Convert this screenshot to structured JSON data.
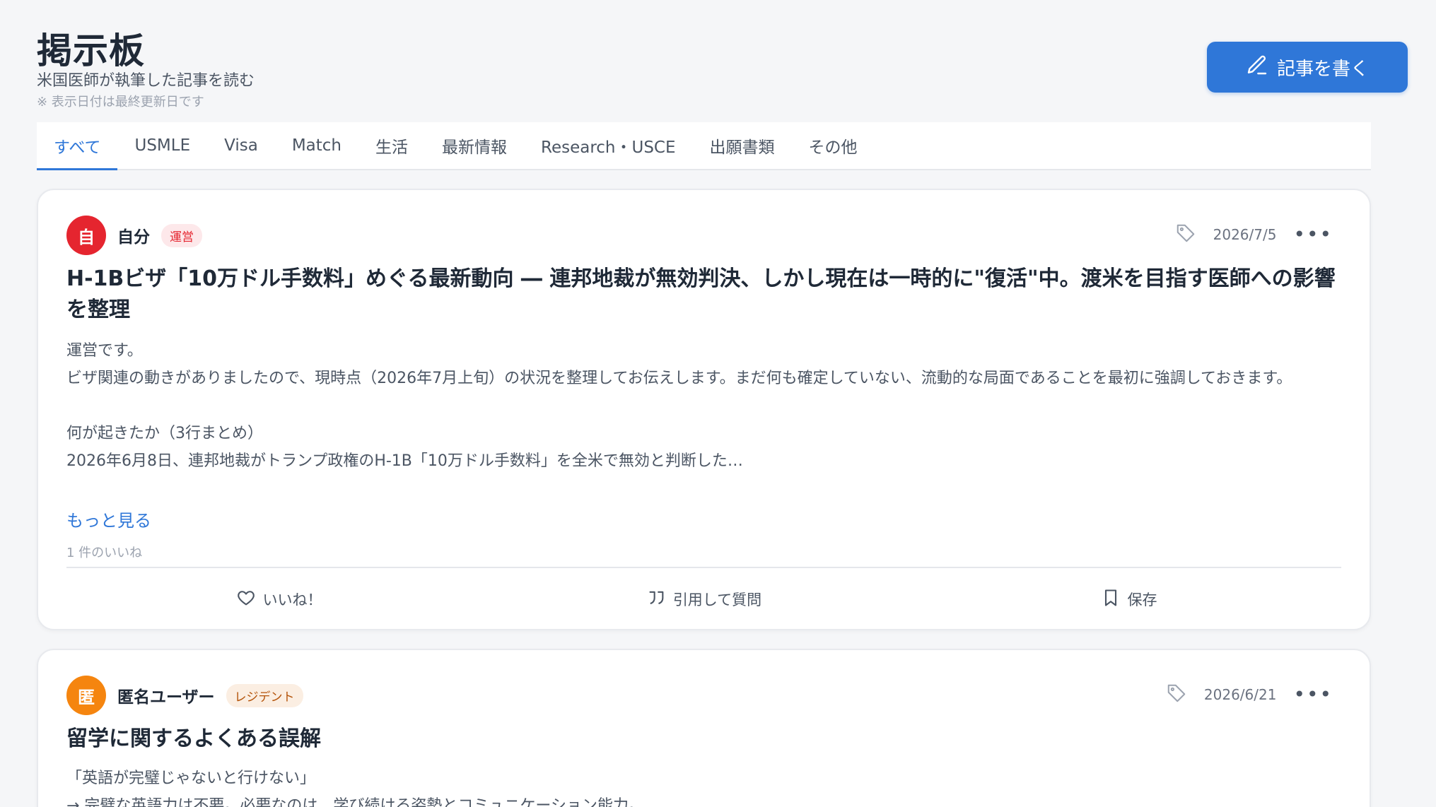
{
  "header": {
    "title": "掲示板",
    "subtitle": "米国医師が執筆した記事を読む",
    "note": "※ 表示日付は最終更新日です",
    "write_button": "記事を書く"
  },
  "tabs": [
    "すべて",
    "USMLE",
    "Visa",
    "Match",
    "生活",
    "最新情報",
    "Research・USCE",
    "出願書類",
    "その他"
  ],
  "active_tab": "すべて",
  "actions": {
    "like": "いいね！",
    "quote": "引用して質問",
    "save": "保存"
  },
  "posts": [
    {
      "avatar": "自",
      "avatar_color": "#e5252f",
      "author": "自分",
      "badge": "運営",
      "badge_color": "#e5252f",
      "date": "2026/7/5",
      "title": "H-1Bビザ「10万ドル手数料」めぐる最新動向 ― 連邦地裁が無効判決、しかし現在は一時的に\"復活\"中。渡米を目指す医師への影響を整理",
      "body": [
        "運営です。",
        "ビザ関連の動きがありましたので、現時点（2026年7月上旬）の状況を整理してお伝えします。まだ何も確定していない、流動的な局面であることを最初に強調しておきます。",
        "",
        "何が起きたか（3行まとめ）",
        "2026年6月8日、連邦地裁がトランプ政権のH-1B「10万ドル手数料」を全米で無効と判断した…"
      ],
      "more_link": "もっと見る",
      "likes": "1 件のいいね"
    },
    {
      "avatar": "匿",
      "avatar_color": "#f5850f",
      "author": "匿名ユーザー",
      "badge": "レジデント",
      "badge_color": "#b45309",
      "date": "2026/6/21",
      "title": "留学に関するよくある誤解",
      "body": [
        "「英語が完璧じゃないと行けない」",
        "→ 完璧な英語力は不要。必要なのは、学び続ける姿勢とコミュニケーション能力。"
      ]
    }
  ]
}
